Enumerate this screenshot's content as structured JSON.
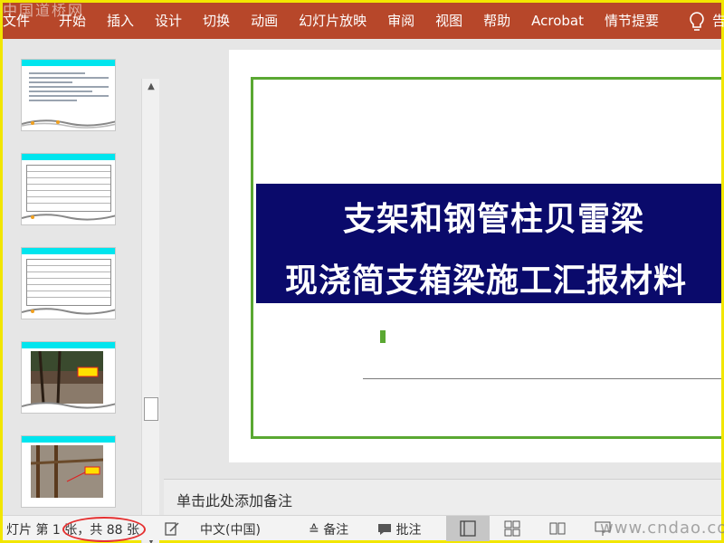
{
  "ribbon": {
    "file_label": "文件",
    "tabs": [
      "开始",
      "插入",
      "设计",
      "切换",
      "动画",
      "幻灯片放映",
      "审阅",
      "视图",
      "帮助",
      "Acrobat",
      "情节提要"
    ],
    "tell_me_label": "告",
    "watermark": "中国道桥网",
    "color": "#b7472a"
  },
  "thumbnails": [
    {
      "type": "text-bullets"
    },
    {
      "type": "table"
    },
    {
      "type": "table"
    },
    {
      "type": "photo-construction"
    },
    {
      "type": "photo-formwork"
    }
  ],
  "slide": {
    "title_line1": "支架和钢管柱贝雷梁",
    "title_line2": "现浇简支箱梁施工汇报材料",
    "band_color": "#0a0a6b",
    "frame_color": "#5aa832"
  },
  "notes": {
    "placeholder": "单击此处添加备注"
  },
  "status_bar": {
    "slide_count": "灯片 第 1 张，共 88 张",
    "language": "中文(中国)",
    "notes_label": "备注",
    "comments_label": "批注",
    "watermark": "www.cndao.com"
  },
  "icons": [
    "lightbulb-icon",
    "scroll-up-icon",
    "scroll-down-icon",
    "notes-edit-icon",
    "notes-icon",
    "comment-icon",
    "normal-view-icon",
    "slide-sorter-icon",
    "reading-view-icon",
    "slideshow-icon"
  ]
}
